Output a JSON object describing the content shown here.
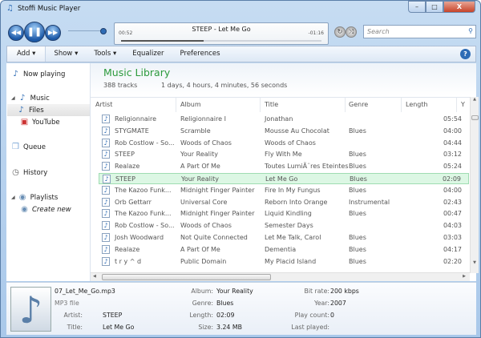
{
  "window": {
    "title": "Stoffi Music Player",
    "minimize": "–",
    "maximize": "□",
    "close": "X"
  },
  "player": {
    "now_playing": "STEEP - Let Me Go",
    "elapsed": "00:52",
    "remaining": "-01:16",
    "progress": 0.41,
    "volume": 0.95,
    "search_placeholder": "Search"
  },
  "toolbar": {
    "items": [
      "Add ▾",
      "Show ▾",
      "Tools ▾",
      "Equalizer",
      "Preferences"
    ],
    "help": "?"
  },
  "sidebar": {
    "now_playing": "Now playing",
    "music": "Music",
    "files": "Files",
    "youtube": "YouTube",
    "queue": "Queue",
    "history": "History",
    "playlists": "Playlists",
    "create_new": "Create new"
  },
  "library": {
    "title": "Music Library",
    "track_count": "388 tracks",
    "duration": "1 days, 4 hours, 4 minutes, 56 seconds",
    "columns": [
      "Artist",
      "Album",
      "Title",
      "Genre",
      "Length",
      "Y"
    ],
    "rows": [
      [
        "Religionnaire",
        "Religionnaire I",
        "Jonathan",
        "",
        "05:54"
      ],
      [
        "STYGMATE",
        "Scramble",
        "Mousse Au Chocolat",
        "Blues",
        "04:00"
      ],
      [
        "Rob Costlow - So...",
        "Woods of Chaos",
        "Woods of Chaos",
        "",
        "04:44"
      ],
      [
        "STEEP",
        "Your Reality",
        "Fly With Me",
        "Blues",
        "03:12"
      ],
      [
        "Realaze",
        "A Part Of Me",
        "Toutes LumiÃ¨res Eteintes",
        "Blues",
        "05:24"
      ],
      [
        "STEEP",
        "Your Reality",
        "Let Me Go",
        "Blues",
        "02:09"
      ],
      [
        "The Kazoo Funk...",
        "Midnight Finger Painter",
        "Fire In My Fungus",
        "Blues",
        "04:00"
      ],
      [
        "Orb Gettarr",
        "Universal Core",
        "Reborn Into Orange",
        "Instrumental",
        "02:43"
      ],
      [
        "The Kazoo Funk...",
        "Midnight Finger Painter",
        "Liquid Kindling",
        "Blues",
        "00:47"
      ],
      [
        "Rob Costlow - So...",
        "Woods of Chaos",
        "Semester Days",
        "",
        "04:03"
      ],
      [
        "Josh Woodward",
        "Not Quite Connected",
        "Let Me Talk, Carol",
        "Blues",
        "03:03"
      ],
      [
        "Realaze",
        "A Part Of Me",
        "Dementia",
        "Blues",
        "04:17"
      ],
      [
        "t r y ^ d",
        "Public Domain",
        "My Placid Island",
        "Blues",
        "02:20"
      ]
    ],
    "selected_index": 5
  },
  "details": {
    "filename": "07_Let_Me_Go.mp3",
    "filetype": "MP3 file",
    "fields": [
      {
        "label": "Artist:",
        "value": "STEEP"
      },
      {
        "label": "Title:",
        "value": "Let Me Go"
      },
      {
        "label": "Album:",
        "value": "Your Reality"
      },
      {
        "label": "Genre:",
        "value": "Blues"
      },
      {
        "label": "Length:",
        "value": "02:09"
      },
      {
        "label": "Size:",
        "value": "3.24 MB"
      },
      {
        "label": "Bit rate:",
        "value": "200 kbps"
      },
      {
        "label": "Year:",
        "value": "2007"
      },
      {
        "label": "Play count:",
        "value": "0"
      },
      {
        "label": "Last played:",
        "value": ""
      }
    ]
  }
}
